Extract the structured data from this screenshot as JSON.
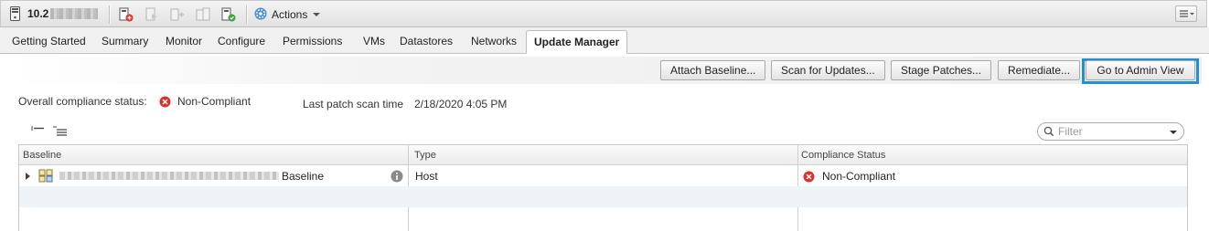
{
  "header": {
    "host_name": "10.2",
    "actions_label": "Actions"
  },
  "tabs": [
    {
      "label": "Getting Started"
    },
    {
      "label": "Summary"
    },
    {
      "label": "Monitor"
    },
    {
      "label": "Configure"
    },
    {
      "label": "Permissions"
    },
    {
      "label": "VMs"
    },
    {
      "label": "Datastores"
    },
    {
      "label": "Networks"
    },
    {
      "label": "Update Manager",
      "active": true
    }
  ],
  "buttons": {
    "attach_baseline": "Attach Baseline...",
    "scan_for_updates": "Scan for Updates...",
    "stage_patches": "Stage Patches...",
    "remediate": "Remediate...",
    "go_to_admin_view": "Go to Admin View"
  },
  "status": {
    "compliance_label": "Overall compliance status:",
    "compliance_value": "Non-Compliant",
    "scan_label": "Last patch scan time",
    "scan_value": "2/18/2020 4:05 PM"
  },
  "filter": {
    "placeholder": "Filter"
  },
  "table": {
    "columns": [
      "Baseline",
      "Type",
      "Compliance Status"
    ],
    "rows": [
      {
        "baseline": "Baseline",
        "type": "Host",
        "compliance_status": "Non-Compliant"
      }
    ]
  },
  "colors": {
    "focus_outline": "#1f8fd6",
    "error_red": "#d9322c",
    "alt_row": "#eef3f8"
  }
}
